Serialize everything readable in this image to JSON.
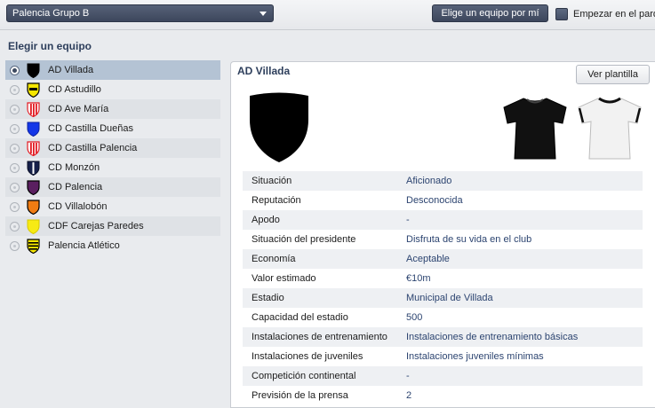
{
  "header": {
    "league_select": "Palencia Grupo B",
    "choose_button": "Elige un equipo por mí",
    "start_label": "Empezar en el parq"
  },
  "left": {
    "title": "Elegir un equipo",
    "teams": [
      {
        "name": "AD Villada",
        "selected": true,
        "crest_colors": [
          "#000000",
          "#000000"
        ]
      },
      {
        "name": "CD Astudillo",
        "selected": false,
        "crest_colors": [
          "#f5e600",
          "#000000"
        ]
      },
      {
        "name": "CD Ave María",
        "selected": false,
        "crest_colors": [
          "#e21b23",
          "#ffffff"
        ]
      },
      {
        "name": "CD Castilla Dueñas",
        "selected": false,
        "crest_colors": [
          "#1437e8",
          "#1437e8"
        ]
      },
      {
        "name": "CD Castilla Palencia",
        "selected": false,
        "crest_colors": [
          "#e21b23",
          "#ffffff"
        ]
      },
      {
        "name": "CD Monzón",
        "selected": false,
        "crest_colors": [
          "#16204a",
          "#ffffff"
        ]
      },
      {
        "name": "CD Palencia",
        "selected": false,
        "crest_colors": [
          "#5a1f60",
          "#000000"
        ]
      },
      {
        "name": "CD Villalobón",
        "selected": false,
        "crest_colors": [
          "#f07c12",
          "#f07c12"
        ]
      },
      {
        "name": "CDF Carejas Paredes",
        "selected": false,
        "crest_colors": [
          "#f7ea14",
          "#f7ea14"
        ]
      },
      {
        "name": "Palencia Atlético",
        "selected": false,
        "crest_colors": [
          "#f5e600",
          "#000000"
        ]
      }
    ]
  },
  "detail": {
    "title": "AD Villada",
    "squad_button": "Ver plantilla",
    "kit_colors": {
      "home": "#111111",
      "away": "#f2f2f2"
    },
    "rows": [
      {
        "label": "Situación",
        "value": "Aficionado"
      },
      {
        "label": "Reputación",
        "value": "Desconocida"
      },
      {
        "label": "Apodo",
        "value": "-"
      },
      {
        "label": "Situación del presidente",
        "value": "Disfruta de su vida en el club"
      },
      {
        "label": "Economía",
        "value": "Aceptable"
      },
      {
        "label": "Valor estimado",
        "value": "€10m"
      },
      {
        "label": "Estadio",
        "value": "Municipal de Villada"
      },
      {
        "label": "Capacidad del estadio",
        "value": "500"
      },
      {
        "label": "Instalaciones de entrenamiento",
        "value": "Instalaciones de entrenamiento básicas"
      },
      {
        "label": "Instalaciones de juveniles",
        "value": "Instalaciones juveniles mínimas"
      },
      {
        "label": "Competición continental",
        "value": "-"
      },
      {
        "label": "Previsión de la prensa",
        "value": "2"
      }
    ]
  }
}
